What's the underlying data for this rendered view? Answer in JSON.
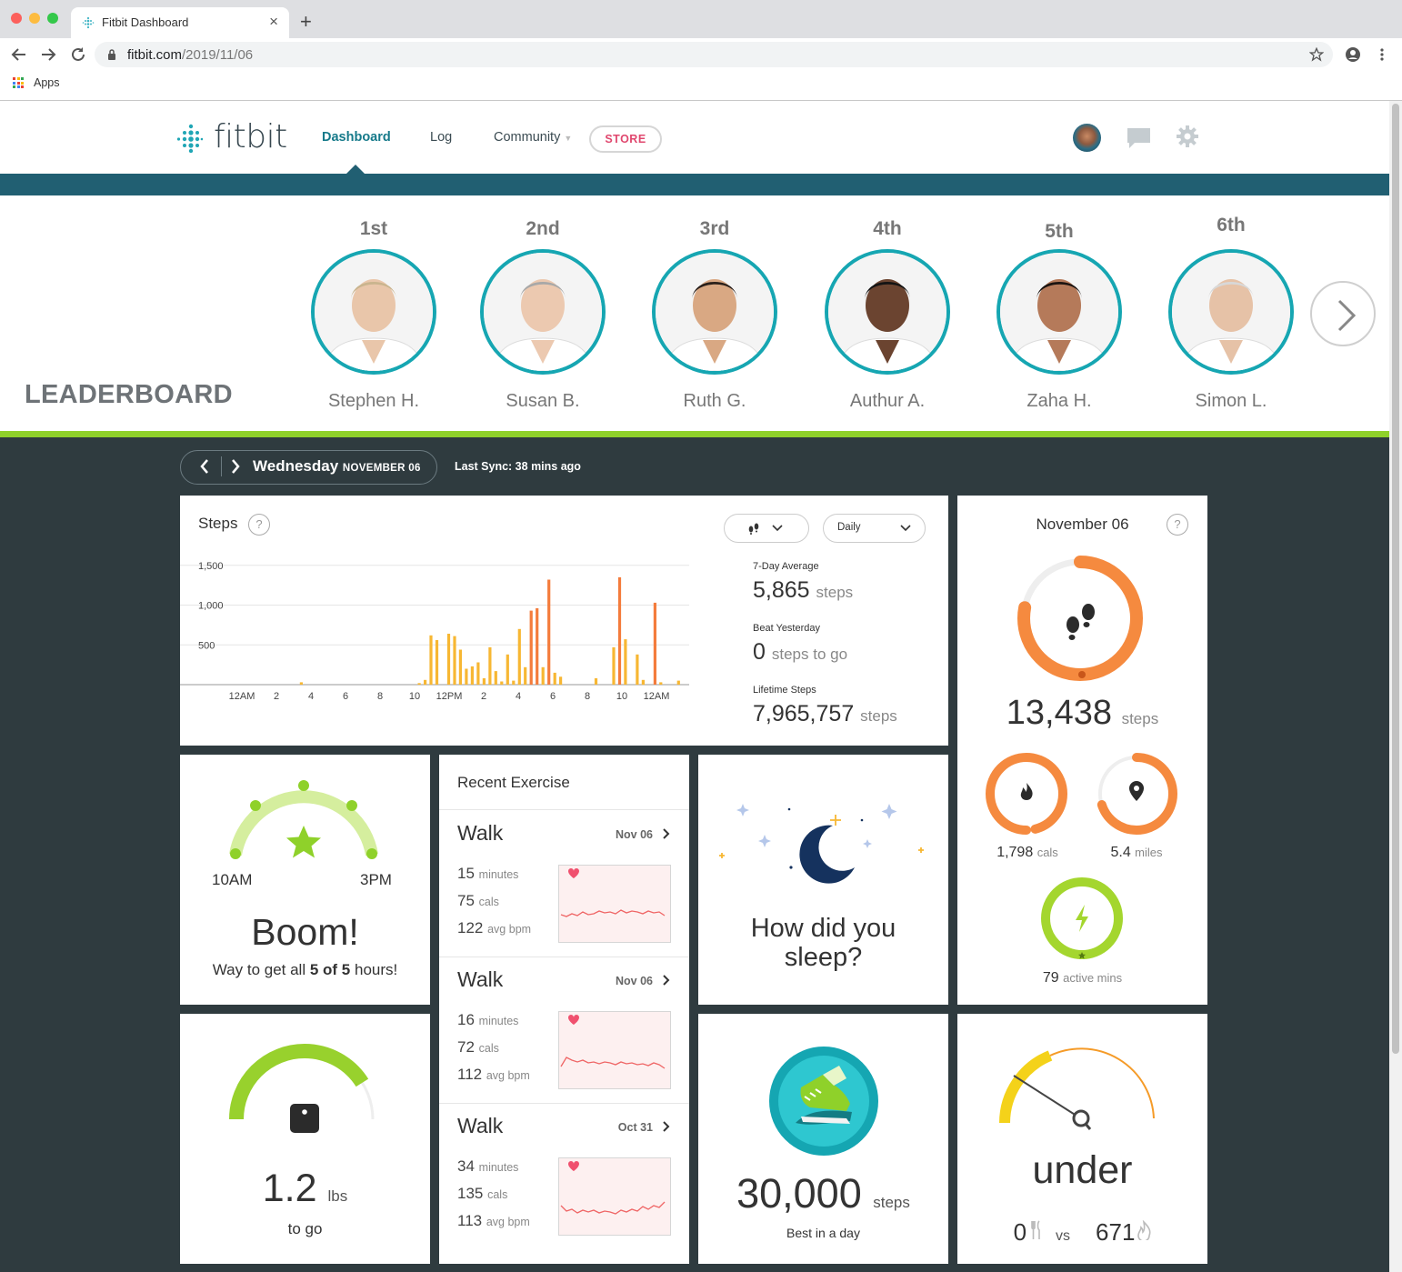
{
  "browser": {
    "tab_title": "Fitbit Dashboard",
    "tab_close": "×",
    "new_tab": "+",
    "url_domain": "fitbit.com",
    "url_path": "/2019/11/06",
    "bookmark_apps": "Apps"
  },
  "nav": {
    "logo": "fitbit",
    "items": [
      "Dashboard",
      "Log",
      "Community"
    ],
    "store": "STORE"
  },
  "leaderboard": {
    "title": "LEADERBOARD",
    "people": [
      {
        "rank": "1st",
        "name": "Stephen H."
      },
      {
        "rank": "2nd",
        "name": "Susan B."
      },
      {
        "rank": "3rd",
        "name": "Ruth G."
      },
      {
        "rank": "4th",
        "name": "Authur A."
      },
      {
        "rank": "5th",
        "name": "Zaha H."
      },
      {
        "rank": "6th",
        "name": "Simon L."
      }
    ]
  },
  "datebar": {
    "day": "Wednesday",
    "date": "NOVEMBER 06",
    "sync": "Last Sync: 38 mins ago"
  },
  "steps_card": {
    "title": "Steps",
    "help": "?",
    "period": "Daily",
    "avg_label": "7-Day Average",
    "avg_value": "5,865",
    "avg_unit": "steps",
    "beat_label": "Beat Yesterday",
    "beat_value": "0",
    "beat_unit": "steps to go",
    "life_label": "Lifetime Steps",
    "life_value": "7,965,757",
    "life_unit": "steps"
  },
  "chart_data": {
    "type": "bar",
    "ylabel": "",
    "xlabel": "",
    "ylim": [
      0,
      1600
    ],
    "yticks": [
      "1,500",
      "1,000",
      "500"
    ],
    "ytick_values": [
      1500,
      1000,
      500
    ],
    "xticks": [
      "12AM",
      "2",
      "4",
      "6",
      "8",
      "10",
      "12PM",
      "2",
      "4",
      "6",
      "8",
      "10",
      "12AM"
    ],
    "interval_minutes": 15,
    "colors": {
      "low": "#f7b733",
      "high": "#f47c3c"
    },
    "bars": [
      {
        "slot": 10,
        "value": 30
      },
      {
        "slot": 30,
        "value": 20
      },
      {
        "slot": 31,
        "value": 60
      },
      {
        "slot": 32,
        "value": 620
      },
      {
        "slot": 33,
        "value": 560
      },
      {
        "slot": 35,
        "value": 640
      },
      {
        "slot": 36,
        "value": 610
      },
      {
        "slot": 37,
        "value": 440
      },
      {
        "slot": 38,
        "value": 200
      },
      {
        "slot": 39,
        "value": 230
      },
      {
        "slot": 40,
        "value": 280
      },
      {
        "slot": 41,
        "value": 80
      },
      {
        "slot": 42,
        "value": 470
      },
      {
        "slot": 43,
        "value": 170
      },
      {
        "slot": 44,
        "value": 40
      },
      {
        "slot": 45,
        "value": 380
      },
      {
        "slot": 46,
        "value": 50
      },
      {
        "slot": 47,
        "value": 700
      },
      {
        "slot": 48,
        "value": 220
      },
      {
        "slot": 49,
        "value": 930
      },
      {
        "slot": 50,
        "value": 960
      },
      {
        "slot": 51,
        "value": 220
      },
      {
        "slot": 52,
        "value": 1320
      },
      {
        "slot": 53,
        "value": 150
      },
      {
        "slot": 54,
        "value": 100
      },
      {
        "slot": 60,
        "value": 80
      },
      {
        "slot": 63,
        "value": 470
      },
      {
        "slot": 64,
        "value": 1350
      },
      {
        "slot": 65,
        "value": 570
      },
      {
        "slot": 67,
        "value": 380
      },
      {
        "slot": 68,
        "value": 60
      },
      {
        "slot": 70,
        "value": 1030
      },
      {
        "slot": 71,
        "value": 30
      },
      {
        "slot": 74,
        "value": 50
      }
    ]
  },
  "summary": {
    "date": "November 06",
    "help": "?",
    "steps_value": "13,438",
    "steps_unit": "steps",
    "steps_progress": 0.78,
    "cals_value": "1,798",
    "cals_unit": "cals",
    "cals_progress": 0.96,
    "miles_value": "5.4",
    "miles_unit": "miles",
    "miles_progress": 0.7,
    "active_value": "79",
    "active_unit": "active mins",
    "active_progress": 1.0
  },
  "hourly": {
    "start": "10AM",
    "end": "3PM",
    "headline": "Boom!",
    "prefix": "Way to get all",
    "bold": "5 of 5",
    "suffix": "hours!"
  },
  "exercise": {
    "title": "Recent Exercise",
    "items": [
      {
        "name": "Walk",
        "date": "Nov 06",
        "minutes": "15",
        "minutes_unit": "minutes",
        "cals": "75",
        "cals_unit": "cals",
        "bpm": "122",
        "bpm_unit": "avg bpm"
      },
      {
        "name": "Walk",
        "date": "Nov 06",
        "minutes": "16",
        "minutes_unit": "minutes",
        "cals": "72",
        "cals_unit": "cals",
        "bpm": "112",
        "bpm_unit": "avg bpm"
      },
      {
        "name": "Walk",
        "date": "Oct 31",
        "minutes": "34",
        "minutes_unit": "minutes",
        "cals": "135",
        "cals_unit": "cals",
        "bpm": "113",
        "bpm_unit": "avg bpm"
      }
    ]
  },
  "sleep": {
    "question": "How did you sleep?"
  },
  "weight": {
    "value": "1.2",
    "unit": "lbs",
    "label": "to go",
    "progress": 0.82
  },
  "best": {
    "value": "30,000",
    "unit": "steps",
    "label": "Best in a day"
  },
  "food": {
    "status": "under",
    "eaten": "0",
    "vs": "vs",
    "burned": "671"
  }
}
